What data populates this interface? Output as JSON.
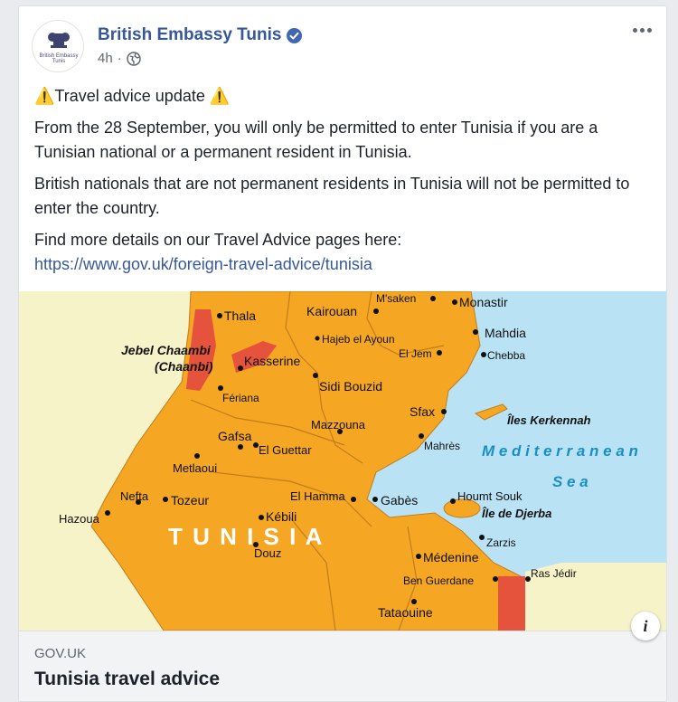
{
  "post": {
    "page_name": "British Embassy Tunis",
    "avatar_text": "British Embassy Tunis",
    "time": "4h",
    "dot": "·",
    "privacy_icon": "globe-icon",
    "verified_icon": "verified-badge-icon",
    "more_icon": "more-options-icon",
    "paragraphs": {
      "heading_warn_left": "⚠️",
      "heading": "Travel advice update ",
      "heading_warn_right": "⚠️",
      "p1": "From the 28 September, you will only be permitted to enter Tunisia if you are a Tunisian national or a permanent resident in Tunisia.",
      "p2": "British nationals that are not permanent residents in Tunisia will not be permitted to enter the country.",
      "p3": "Find more details on our Travel Advice pages here:",
      "link": "https://www.gov.uk/foreign-travel-advice/tunisia"
    }
  },
  "map": {
    "country_label": "T U N I S I A",
    "sea_label_1": "M e d i t e r r a n e a n",
    "sea_label_2": "S e a",
    "places": {
      "thala": "Thala",
      "kairouan": "Kairouan",
      "msaken": "M'saken",
      "monastir": "Monastir",
      "mahdia": "Mahdia",
      "chebba": "Chebba",
      "jebel": "Jebel Chaambi",
      "chaanbi": "(Chaanbi)",
      "kasserine": "Kasserine",
      "hajeb": "Hajeb el Ayoun",
      "eljem": "El Jem",
      "sidibouzid": "Sidi Bouzid",
      "sfax": "Sfax",
      "kerkennah": "Îles Kerkennah",
      "feriana": "Fériana",
      "mazzouna": "Mazzouna",
      "mahres": "Mahrès",
      "gafsa": "Gafsa",
      "elguettar": "El Guettar",
      "metlaoui": "Metlaoui",
      "nefta": "Nefta",
      "tozeur": "Tozeur",
      "elhamma": "El Hamma",
      "gabes": "Gabès",
      "houmtsouk": "Houmt Souk",
      "djerba": "Île de Djerba",
      "hazoua": "Hazoua",
      "kebili": "Kébili",
      "zarzis": "Zarzis",
      "douz": "Douz",
      "medenine": "Médenine",
      "benguerdane": "Ben Guerdane",
      "rasjedir": "Ras Jédir",
      "tataouine": "Tataouine"
    }
  },
  "link_preview": {
    "domain": "GOV.UK",
    "title": "Tunisia travel advice",
    "info_icon": "info-icon",
    "info_label": "i"
  },
  "colors": {
    "brand_link": "#365899",
    "map_orange": "#f5a623",
    "map_red": "#e5533c",
    "map_sea": "#b9e3f5",
    "map_land_other": "#f7f3c9"
  }
}
